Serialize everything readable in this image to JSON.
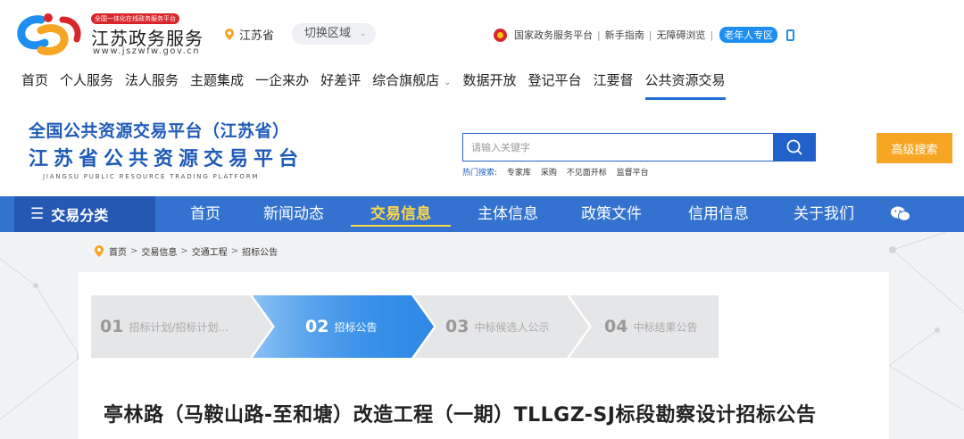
{
  "logo": {
    "tag": "全国一体化在线政务服务平台",
    "name": "江苏政务服务",
    "url": "www.jszwfw.gov.cn"
  },
  "region": {
    "current": "江苏省",
    "switch_label": "切换区域"
  },
  "toplinks": {
    "national": "国家政务服务平台",
    "guide": "新手指南",
    "accessible": "无障碍浏览",
    "elder": "老年人专区"
  },
  "main_nav": {
    "items": [
      {
        "label": "首页"
      },
      {
        "label": "个人服务"
      },
      {
        "label": "法人服务"
      },
      {
        "label": "主题集成"
      },
      {
        "label": "一企来办"
      },
      {
        "label": "好差评"
      },
      {
        "label": "综合旗舰店"
      },
      {
        "label": "数据开放"
      },
      {
        "label": "登记平台"
      },
      {
        "label": "江要督"
      },
      {
        "label": "公共资源交易"
      }
    ],
    "active_index": 10
  },
  "brand": {
    "line1": "全国公共资源交易平台（江苏省）",
    "line2": "江苏省公共资源交易平台",
    "line3": "JIANGSU PUBLIC RESOURCE TRADING PLATFORM"
  },
  "search": {
    "placeholder": "请输入关键字",
    "hot_label": "热门搜索:",
    "hot_items": [
      "专家库",
      "采购",
      "不见面开标",
      "监督平台"
    ],
    "advanced_label": "高级搜索"
  },
  "blue_nav": {
    "category_label": "交易分类",
    "items": [
      {
        "label": "首页"
      },
      {
        "label": "新闻动态"
      },
      {
        "label": "交易信息"
      },
      {
        "label": "主体信息"
      },
      {
        "label": "政策文件"
      },
      {
        "label": "信用信息"
      },
      {
        "label": "关于我们"
      }
    ],
    "active_index": 2
  },
  "breadcrumb": [
    "首页",
    "交易信息",
    "交通工程",
    "招标公告"
  ],
  "steps": [
    {
      "num": "01",
      "label": "招标计划/招标计划..."
    },
    {
      "num": "02",
      "label": "招标公告"
    },
    {
      "num": "03",
      "label": "中标候选人公示"
    },
    {
      "num": "04",
      "label": "中标结果公告"
    }
  ],
  "current_step_index": 1,
  "announcement_title": "亭林路（马鞍山路-至和塘）改造工程（一期）TLLGZ-SJ标段勘察设计招标公告",
  "colors": {
    "primary_blue": "#3372cf",
    "dark_blue": "#2558b3",
    "brand_blue": "#1f5bb8",
    "active_yellow": "#ffd84a",
    "advanced_orange": "#f6a623",
    "step_active": "#2f8ae6",
    "step_inactive": "#e5e6e8"
  }
}
